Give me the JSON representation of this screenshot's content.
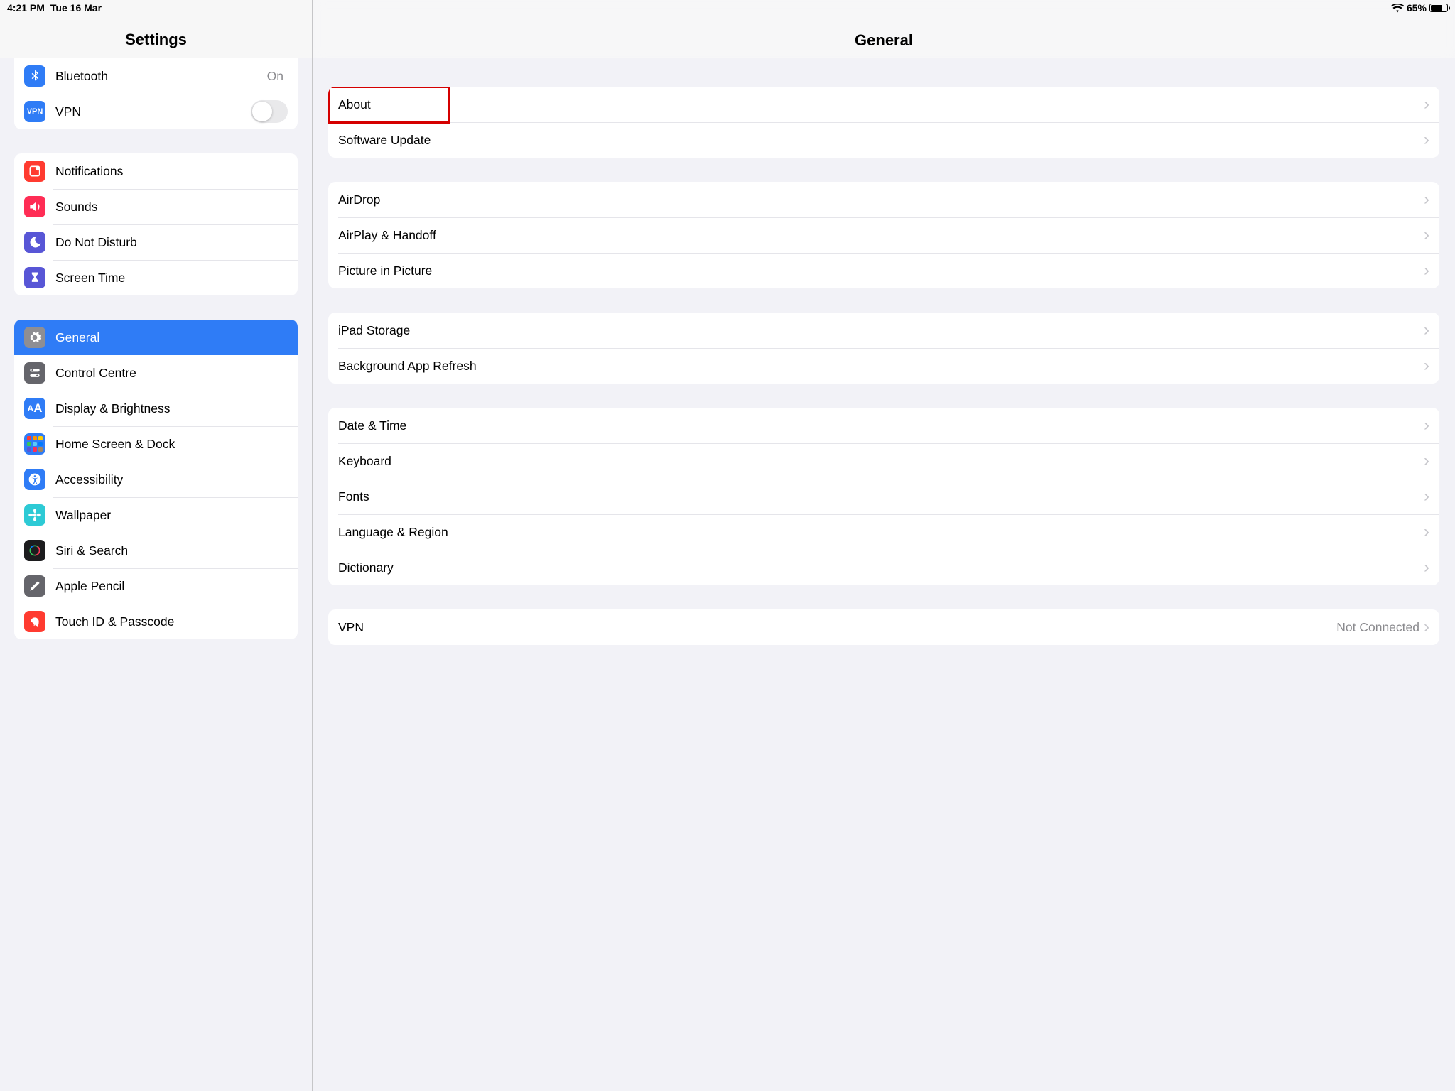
{
  "status": {
    "time": "4:21 PM",
    "date": "Tue 16 Mar",
    "battery": "65%"
  },
  "sidebar": {
    "title": "Settings",
    "g0": {
      "bluetooth": "Bluetooth",
      "bluetooth_value": "On",
      "vpn": "VPN"
    },
    "g1": {
      "notifications": "Notifications",
      "sounds": "Sounds",
      "dnd": "Do Not Disturb",
      "screen_time": "Screen Time"
    },
    "g2": {
      "general": "General",
      "control_centre": "Control Centre",
      "display": "Display & Brightness",
      "home": "Home Screen & Dock",
      "accessibility": "Accessibility",
      "wallpaper": "Wallpaper",
      "siri": "Siri & Search",
      "pencil": "Apple Pencil",
      "touchid": "Touch ID & Passcode"
    }
  },
  "main": {
    "title": "General",
    "g0": {
      "about": "About",
      "software_update": "Software Update"
    },
    "g1": {
      "airdrop": "AirDrop",
      "airplay": "AirPlay & Handoff",
      "pip": "Picture in Picture"
    },
    "g2": {
      "storage": "iPad Storage",
      "bgrefresh": "Background App Refresh"
    },
    "g3": {
      "datetime": "Date & Time",
      "keyboard": "Keyboard",
      "fonts": "Fonts",
      "lang": "Language & Region",
      "dictionary": "Dictionary"
    },
    "g4": {
      "vpn": "VPN",
      "vpn_value": "Not Connected"
    }
  }
}
